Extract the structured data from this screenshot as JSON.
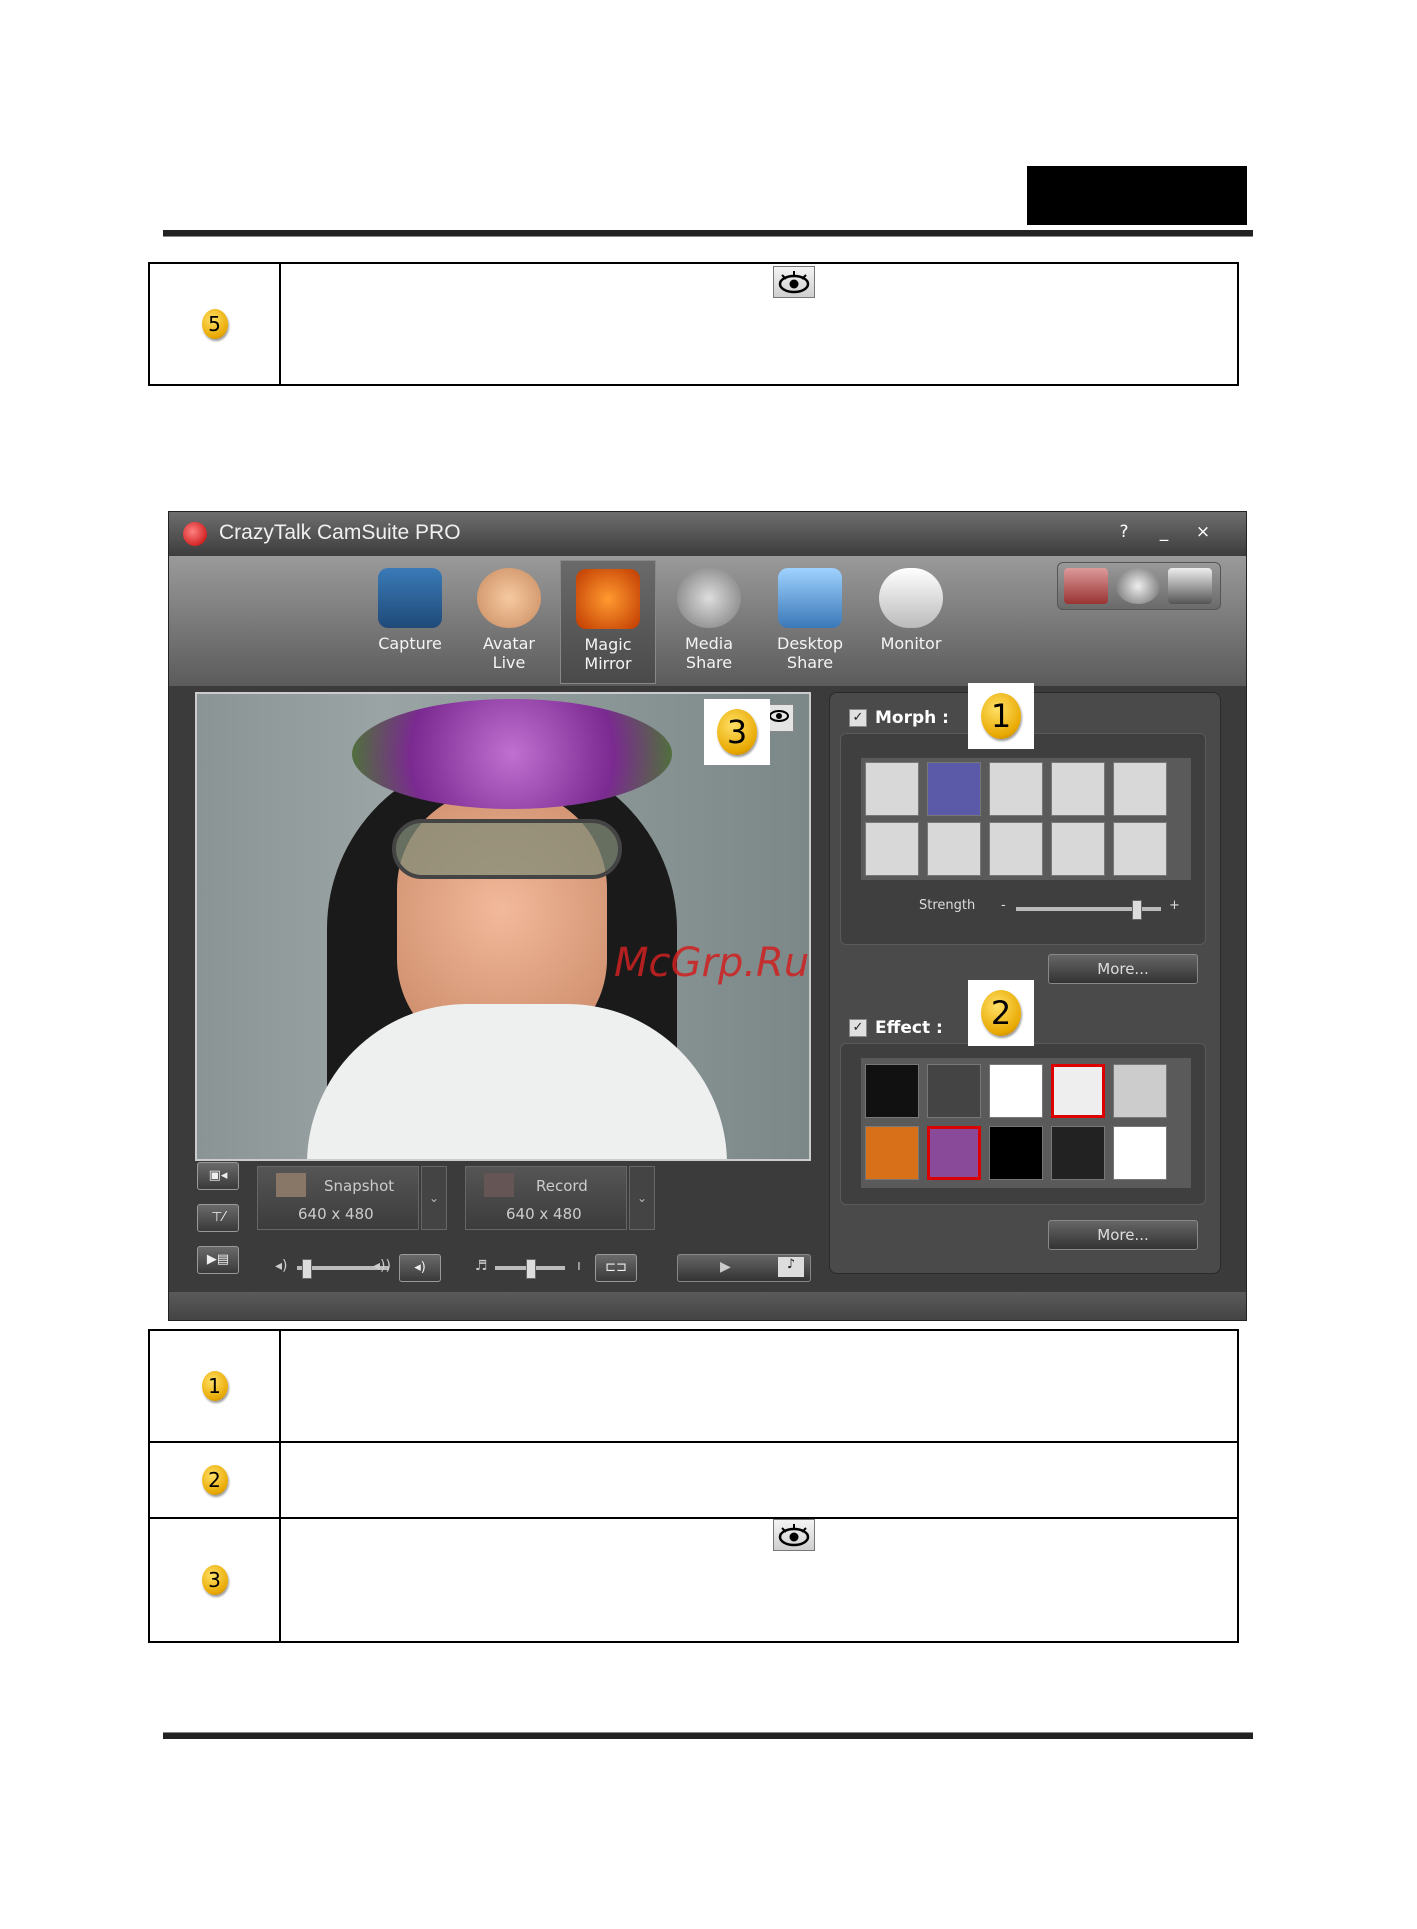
{
  "header": {
    "rule": true
  },
  "top_note": {
    "badge": "5",
    "eye_icon": "eye-icon"
  },
  "app": {
    "title": "CrazyTalk CamSuite PRO",
    "window_buttons": [
      "?",
      "_",
      "×"
    ],
    "tools": [
      {
        "label": "Capture",
        "icon": "webcam-icon"
      },
      {
        "label": "Avatar\nLive",
        "icon": "baby-face-icon"
      },
      {
        "label": "Magic\nMirror",
        "icon": "mask-icon",
        "active": true
      },
      {
        "label": "Media\nShare",
        "icon": "film-reel-icon"
      },
      {
        "label": "Desktop\nShare",
        "icon": "monitors-icon"
      },
      {
        "label": "Monitor",
        "icon": "security-camera-icon"
      }
    ],
    "right_tools": [
      "no-zoom-icon",
      "gear-icon",
      "camera-settings-icon"
    ],
    "callouts": [
      "1",
      "2",
      "3"
    ],
    "morph": {
      "checked": true,
      "label": "Morph :",
      "strength_label": "Strength",
      "strength_level": 0.85,
      "minus": "-",
      "plus": "+",
      "more": "More..."
    },
    "effect": {
      "checked": true,
      "label": "Effect :",
      "more": "More..."
    },
    "snapshot": {
      "label": "Snapshot",
      "size": "640 x 480"
    },
    "record": {
      "label": "Record",
      "size": "640 x 480"
    },
    "volume_level": 0.1,
    "mic_level": 0.5
  },
  "watermark": "McGrp.Ru",
  "bottom_notes": [
    "1",
    "2",
    "3"
  ],
  "colors": {
    "badge": "#e8a800",
    "selected_border": "#dd0000",
    "app_bg": "#3b3b3b"
  }
}
